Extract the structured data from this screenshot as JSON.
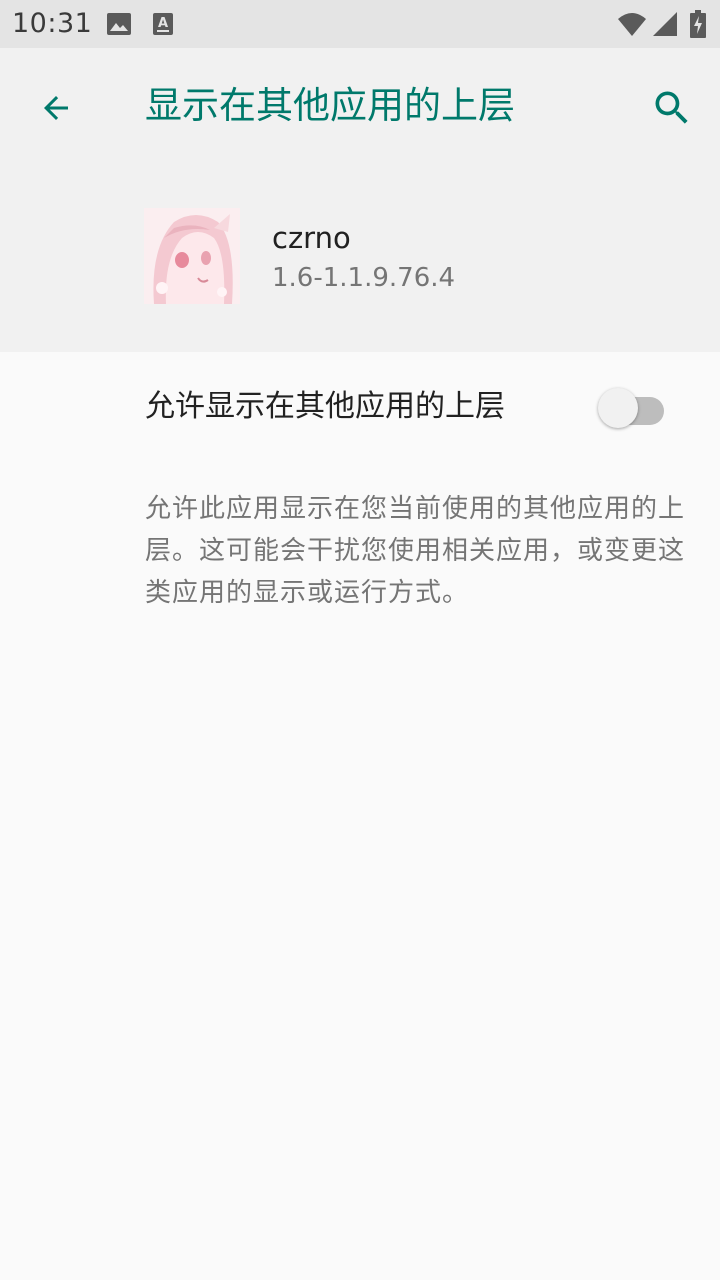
{
  "status_bar": {
    "time": "10:31",
    "icons": [
      "image-icon",
      "accessibility-a-icon",
      "wifi-icon",
      "signal-icon",
      "battery-charging-icon"
    ]
  },
  "header": {
    "title": "显示在其他应用的上层",
    "back_icon": "arrow-back-icon",
    "search_icon": "search-icon"
  },
  "app": {
    "name": "czrno",
    "version": "1.6-1.1.9.76.4"
  },
  "setting": {
    "label": "允许显示在其他应用的上层",
    "enabled": false
  },
  "description": "允许此应用显示在您当前使用的其他应用的上层。这可能会干扰您使用相关应用，或变更这类应用的显示或运行方式。",
  "colors": {
    "accent": "#00796b",
    "header_bg": "#f1f1f1",
    "page_bg": "#fafafa",
    "status_bar_bg": "#e4e4e4"
  }
}
